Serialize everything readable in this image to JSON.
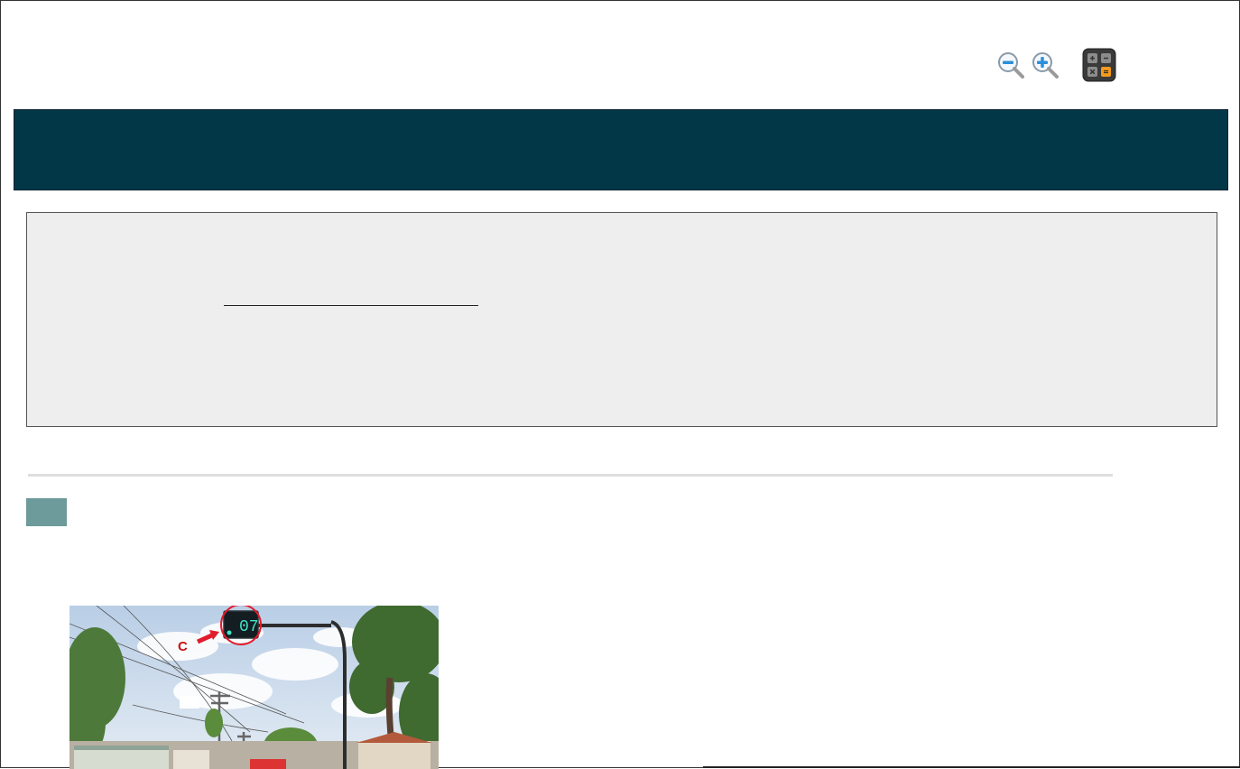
{
  "toolbar": {
    "zoom_out_icon": "zoom-out-icon",
    "zoom_in_icon": "zoom-in-icon",
    "calculator_icon": "calculator-icon"
  },
  "banner": {
    "title": "",
    "background": "#023748"
  },
  "info_box": {
    "text": ""
  },
  "question": {
    "number": ""
  },
  "image": {
    "marker_label": "C",
    "counter_display": "07"
  },
  "colors": {
    "banner": "#023748",
    "info_background": "#eeeeee",
    "question_badge": "#6d9a9a",
    "callout": "#e21c2c",
    "counter_digits": "#41e4c8"
  }
}
